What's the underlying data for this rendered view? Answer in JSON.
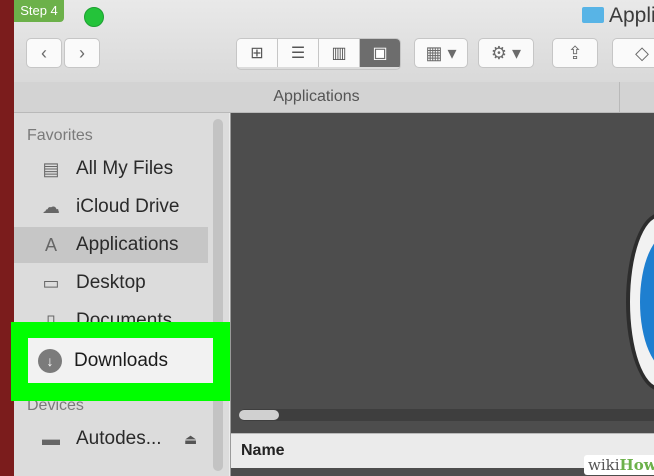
{
  "step_badge": "Step 4",
  "window_title": "Applic",
  "path_title": "Applications",
  "sidebar": {
    "favorites_header": "Favorites",
    "items": [
      {
        "label": "All My Files",
        "icon": "all-files-icon"
      },
      {
        "label": "iCloud Drive",
        "icon": "cloud-icon"
      },
      {
        "label": "Applications",
        "icon": "applications-icon",
        "selected": true
      },
      {
        "label": "Desktop",
        "icon": "desktop-icon"
      },
      {
        "label": "Documents",
        "icon": "documents-icon"
      }
    ],
    "devices_header": "Devices",
    "devices": [
      {
        "label": "Autodes...",
        "icon": "disk-icon"
      }
    ]
  },
  "highlight": {
    "label": "Downloads",
    "icon": "download-icon",
    "color": "#00ff00"
  },
  "list_header": {
    "name_label": "Name"
  },
  "watermark": {
    "prefix": "wiki",
    "suffix": "How"
  }
}
